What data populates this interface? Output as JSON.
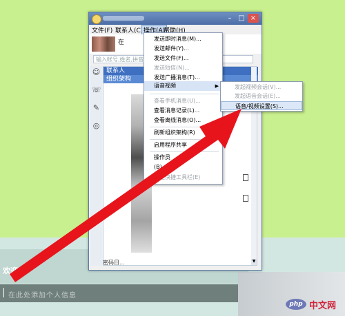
{
  "window": {
    "minimize": "–",
    "maximize": "□",
    "close": "×"
  },
  "menubar": [
    {
      "label": "文件(F)"
    },
    {
      "label": "联系人(C)"
    },
    {
      "label": "操作(A)"
    },
    {
      "label": "帮助(H)"
    }
  ],
  "profile": {
    "status": "在"
  },
  "search": {
    "placeholder": "输入帐号,姓名,拼音"
  },
  "contacts": {
    "group1": "联系人",
    "group2": "组织架构"
  },
  "menu": {
    "items": [
      {
        "label": "发送即时消息(M)..."
      },
      {
        "label": "发送邮件(Y)..."
      },
      {
        "label": "发送文件(F)..."
      },
      {
        "label": "发送短信(N)..."
      },
      {
        "label": "发送广播消息(T)..."
      },
      {
        "label": "语音视频"
      },
      {
        "label": "查看手机消息(U)..."
      },
      {
        "label": "查看消息记录(L)..."
      },
      {
        "label": "查看离线消息(O)..."
      },
      {
        "label": "刷新组织架构(R)"
      },
      {
        "label": "启用程序共享"
      },
      {
        "label": "操作员"
      },
      {
        "label": "(B)"
      },
      {
        "label": "设定快捷工具栏(E)"
      }
    ]
  },
  "submenu": {
    "items": [
      {
        "label": "发起视频会话(V)..."
      },
      {
        "label": "发起语音会话(E)..."
      },
      {
        "label": "语音/视频设置(S)..."
      }
    ]
  },
  "footer": {
    "text": "密码日..."
  },
  "bottom": {
    "left_label": "欢迎",
    "input_text": "在此处添加个人信息"
  },
  "watermark": {
    "logo": "php",
    "text": "中文网"
  },
  "colors": {
    "arrow": "#e8141c",
    "accent": "#3e6fc0"
  }
}
